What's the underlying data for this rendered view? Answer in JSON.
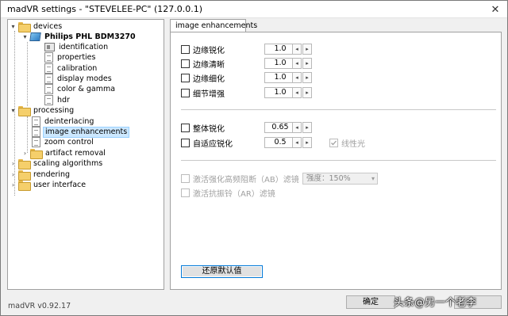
{
  "window": {
    "title": "madVR settings - \"STEVELEE-PC\" (127.0.0.1)",
    "close_glyph": "✕"
  },
  "tree": {
    "devices": "devices",
    "display": "Philips PHL BDM3270",
    "identification": "identification",
    "properties": "properties",
    "calibration": "calibration",
    "display_modes": "display modes",
    "color_gamma": "color & gamma",
    "hdr": "hdr",
    "processing": "processing",
    "deinterlacing": "deinterlacing",
    "image_enhancements": "image enhancements",
    "zoom_control": "zoom control",
    "artifact_removal": "artifact removal",
    "scaling_algorithms": "scaling algorithms",
    "rendering": "rendering",
    "user_interface": "user interface",
    "expanded_glyph": "▾",
    "collapsed_glyph": "›"
  },
  "tab": {
    "label": "image enhancements"
  },
  "sharpening": [
    {
      "label": "边缘锐化",
      "value": "1.0",
      "checked": false
    },
    {
      "label": "边缘清晰",
      "value": "1.0",
      "checked": false
    },
    {
      "label": "边缘细化",
      "value": "1.0",
      "checked": false
    },
    {
      "label": "细节增强",
      "value": "1.0",
      "checked": false
    }
  ],
  "overall": {
    "label": "整体锐化",
    "value": "0.65",
    "checked": false
  },
  "adaptive": {
    "label": "自适应锐化",
    "value": "0.5",
    "checked": false,
    "linear_light_label": "线性光",
    "linear_light_checked": true
  },
  "ab_filter": {
    "label": "激活强化高频阻断（AB）滤镜",
    "strength": "强度：150%"
  },
  "ar_filter": {
    "label": "激活抗振铃（AR）滤镜"
  },
  "spin": {
    "left": "◂",
    "right": "▸",
    "dropdown_arrow": "▾"
  },
  "restore_label": "还原默认值",
  "footer": {
    "version": "madVR v0.92.17",
    "ok_label": "确定"
  },
  "watermark": "头条@另一个老李",
  "colors": {
    "selection_bg": "#cce8ff",
    "focus_border": "#0078d7",
    "folder": "#f5cf6b"
  }
}
